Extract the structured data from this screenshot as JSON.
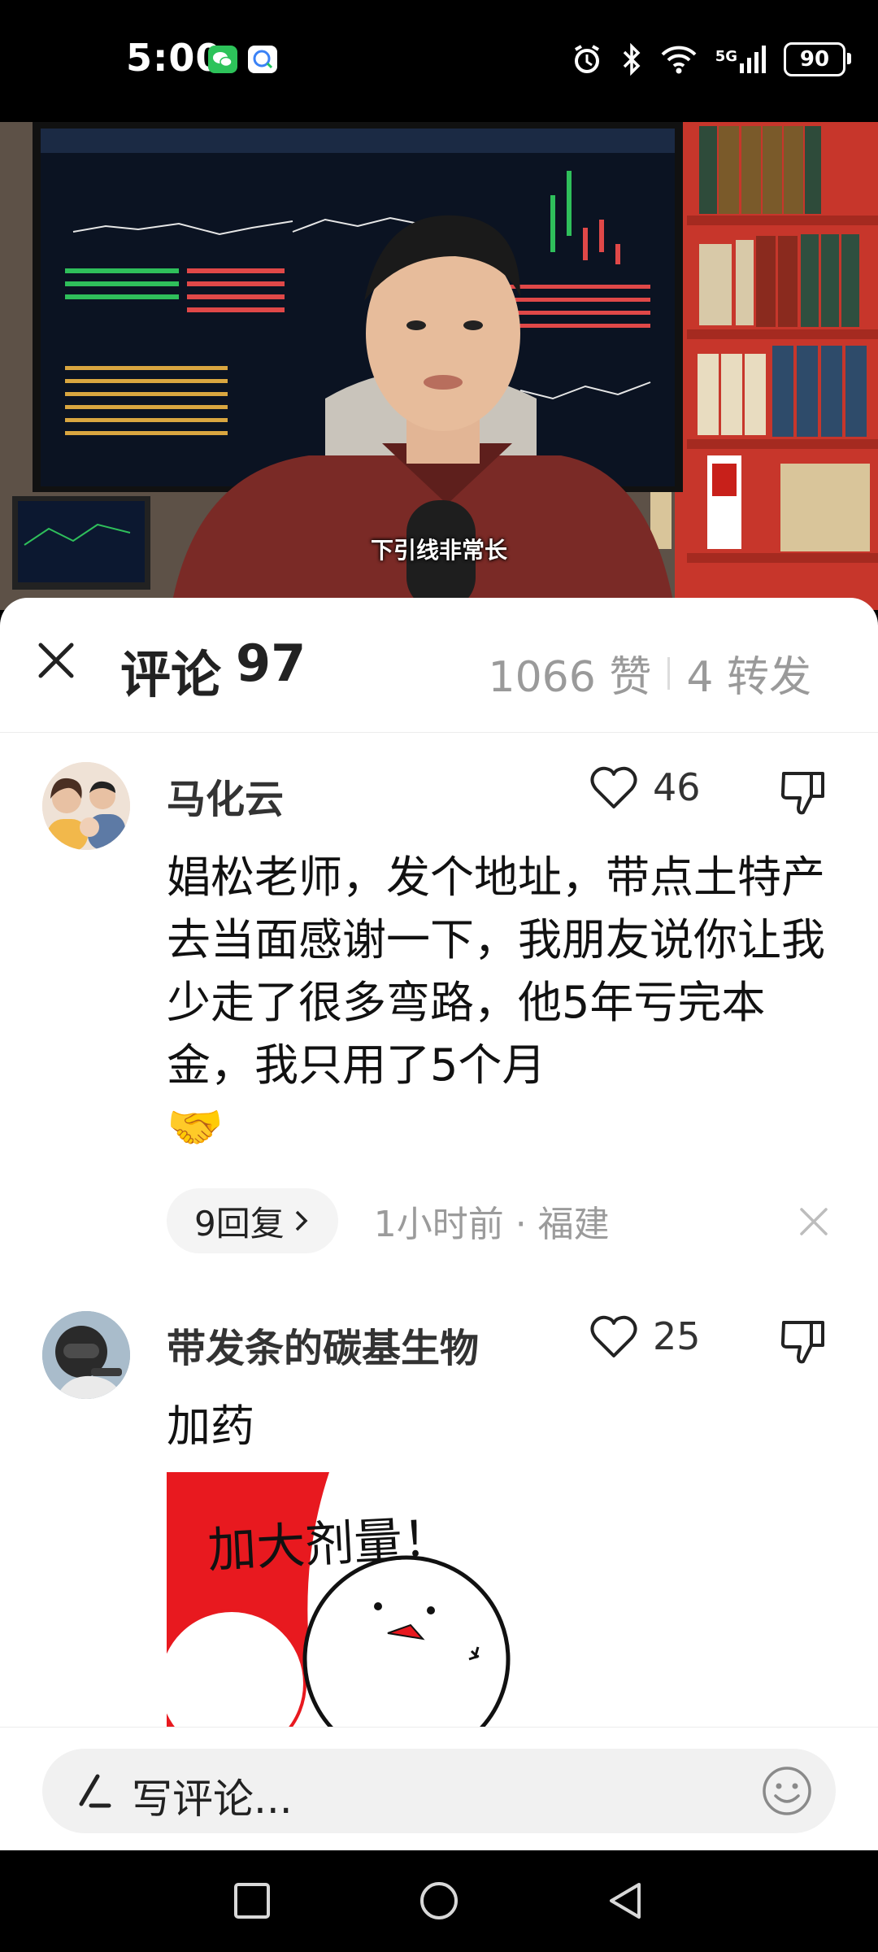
{
  "status_bar": {
    "time": "5:00",
    "network": "5G",
    "battery": "90",
    "icons": [
      "wechat-icon",
      "chat-app-icon",
      "alarm-icon",
      "bluetooth-icon",
      "wifi-icon",
      "signal-icon",
      "battery-icon"
    ]
  },
  "video": {
    "subtitle": "下引线非常长"
  },
  "sheet": {
    "title_label": "评论",
    "title_count": "97",
    "likes_text": "1066 赞",
    "shares_text": "4 转发"
  },
  "comments": [
    {
      "username": "马化云",
      "likes": "46",
      "text": "娼松老师，发个地址，带点土特产去当面感谢一下，我朋友说你让我少走了很多弯路，他5年亏完本金，我只用了5个月",
      "emoji": "🤝",
      "replies_label": "9回复",
      "meta": "1小时前 · 福建"
    },
    {
      "username": "带发条的碳基生物",
      "likes": "25",
      "text": "加药",
      "sticker_text": "加大剂量！"
    }
  ],
  "input": {
    "placeholder": "写评论..."
  },
  "colors": {
    "sheet_bg": "#ffffff",
    "muted_text": "#9b9b9b",
    "pill_bg": "#f4f4f4",
    "sticker_red": "#e8191f"
  }
}
